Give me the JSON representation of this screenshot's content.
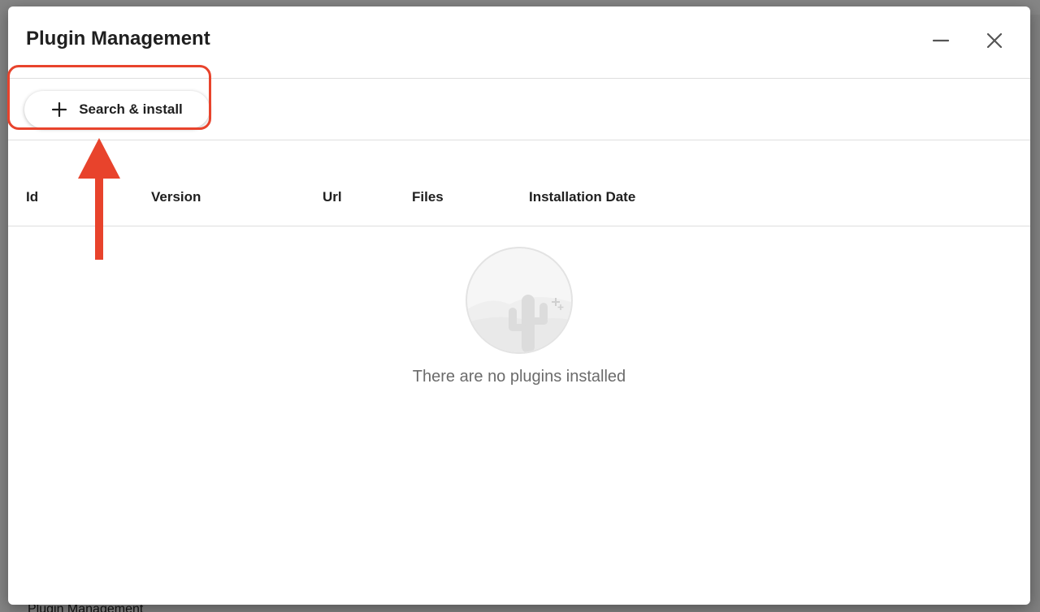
{
  "background": {
    "bottom_text": "Plugin Management"
  },
  "dialog": {
    "title": "Plugin Management",
    "minimize_icon": "minimize-icon",
    "close_icon": "close-icon"
  },
  "toolbar": {
    "search_install_label": "Search & install",
    "plus_icon": "plus-icon"
  },
  "annotation": {
    "highlight_color": "#e8432c"
  },
  "table": {
    "columns": [
      "Id",
      "Version",
      "Url",
      "Files",
      "Installation Date"
    ]
  },
  "empty_state": {
    "icon": "cactus-desert-icon",
    "message": "There are no plugins installed"
  }
}
